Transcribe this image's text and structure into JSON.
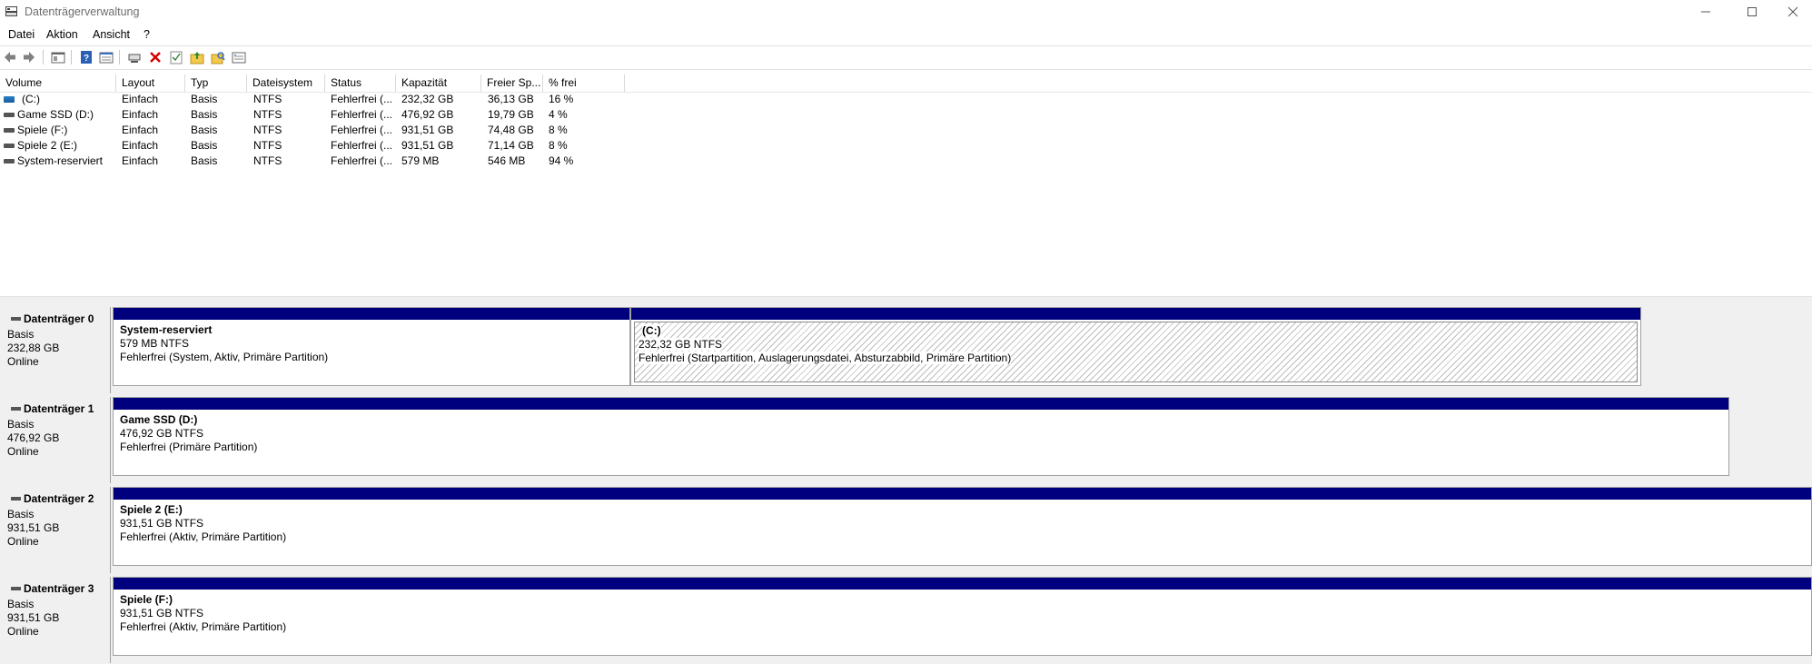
{
  "window": {
    "title": "Datenträgerverwaltung"
  },
  "menu": [
    "Datei",
    "Aktion",
    "Ansicht",
    "?"
  ],
  "toolbar_icons": [
    "back-icon",
    "forward-icon",
    "console-tree-icon",
    "help-icon",
    "properties-icon",
    "connect-icon",
    "delete-icon",
    "check-icon",
    "folder-up-icon",
    "folder-search-icon",
    "list-view-icon"
  ],
  "table": {
    "columns": [
      "Volume",
      "Layout",
      "Typ",
      "Dateisystem",
      "Status",
      "Kapazität",
      "Freier Sp...",
      "% frei"
    ],
    "rows": [
      [
        "(C:)",
        "Einfach",
        "Basis",
        "NTFS",
        "Fehlerfrei (...",
        "232,32 GB",
        "36,13 GB",
        "16 %"
      ],
      [
        "Game SSD (D:)",
        "Einfach",
        "Basis",
        "NTFS",
        "Fehlerfrei (...",
        "476,92 GB",
        "19,79 GB",
        "4 %"
      ],
      [
        "Spiele (F:)",
        "Einfach",
        "Basis",
        "NTFS",
        "Fehlerfrei (...",
        "931,51 GB",
        "74,48 GB",
        "8 %"
      ],
      [
        "Spiele 2 (E:)",
        "Einfach",
        "Basis",
        "NTFS",
        "Fehlerfrei (...",
        "931,51 GB",
        "71,14 GB",
        "8 %"
      ],
      [
        "System-reserviert",
        "Einfach",
        "Basis",
        "NTFS",
        "Fehlerfrei (...",
        "579 MB",
        "546 MB",
        "94 %"
      ]
    ]
  },
  "disks": [
    {
      "name": "Datenträger 0",
      "type": "Basis",
      "size": "232,88 GB",
      "state": "Online",
      "partitions": [
        {
          "title": "System-reserviert",
          "size": "579 MB NTFS",
          "status": "Fehlerfrei (System, Aktiv, Primäre Partition)"
        },
        {
          "title": "(C:)",
          "size": "232,32 GB NTFS",
          "status": "Fehlerfrei (Startpartition, Auslagerungsdatei, Absturzabbild, Primäre Partition)"
        }
      ]
    },
    {
      "name": "Datenträger 1",
      "type": "Basis",
      "size": "476,92 GB",
      "state": "Online",
      "partitions": [
        {
          "title": "Game SSD  (D:)",
          "size": "476,92 GB NTFS",
          "status": "Fehlerfrei (Primäre Partition)"
        }
      ]
    },
    {
      "name": "Datenträger 2",
      "type": "Basis",
      "size": "931,51 GB",
      "state": "Online",
      "partitions": [
        {
          "title": "Spiele 2  (E:)",
          "size": "931,51 GB NTFS",
          "status": "Fehlerfrei (Aktiv, Primäre Partition)"
        }
      ]
    },
    {
      "name": "Datenträger 3",
      "type": "Basis",
      "size": "931,51 GB",
      "state": "Online",
      "partitions": [
        {
          "title": "Spiele  (F:)",
          "size": "931,51 GB NTFS",
          "status": "Fehlerfrei (Aktiv, Primäre Partition)"
        }
      ]
    }
  ],
  "colors": {
    "primary_partition_bar": "#00007f",
    "menu_text": "#000000",
    "title_text": "#6d6d6d"
  }
}
